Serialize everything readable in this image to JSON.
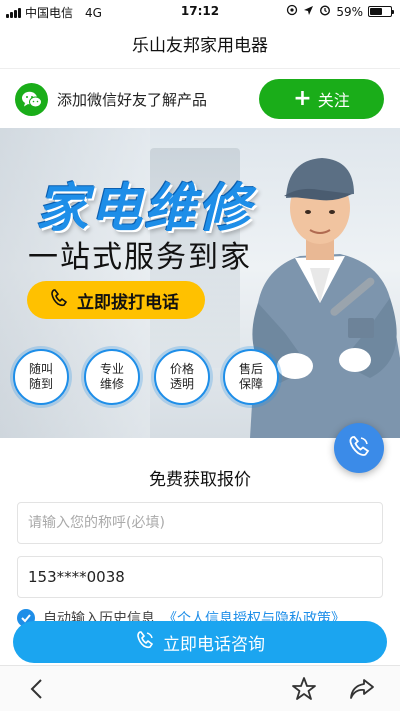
{
  "status_bar": {
    "carrier": "中国电信",
    "network": "4G",
    "time": "17:12",
    "battery": "59%",
    "battery_level": 0.59
  },
  "nav": {
    "title": "乐山友邦家用电器"
  },
  "follow_bar": {
    "text": "添加微信好友了解产品",
    "button_label": "关注",
    "accent": "#1aad19"
  },
  "banner": {
    "title": "家电维修",
    "subtitle": "一站式服务到家",
    "call_label": "立即拔打电话",
    "features": [
      {
        "line1": "随叫",
        "line2": "随到"
      },
      {
        "line1": "专业",
        "line2": "维修"
      },
      {
        "line1": "价格",
        "line2": "透明"
      },
      {
        "line1": "售后",
        "line2": "保障"
      }
    ]
  },
  "form": {
    "title": "免费获取报价",
    "name_placeholder": "请输入您的称呼(必填)",
    "phone_value": "153****0038",
    "consent_text": "自动输入历史信息",
    "consent_link": "《个人信息授权与隐私政策》",
    "submit_label": "立即电话咨询"
  },
  "colors": {
    "primary_blue": "#1e8ee8",
    "submit_blue": "#1ba5f0",
    "call_yellow": "#ffc100",
    "wechat_green": "#1aad19"
  },
  "toolbar": {
    "icons": [
      "back-icon",
      "star-icon",
      "share-icon"
    ]
  }
}
